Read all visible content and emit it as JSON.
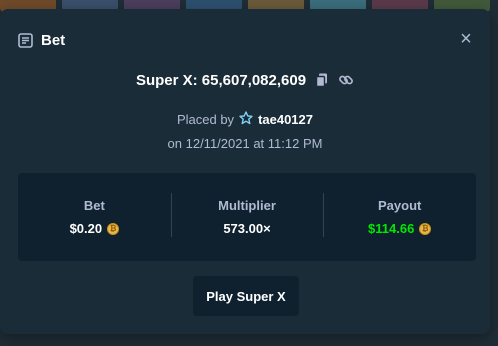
{
  "modal": {
    "title": "Bet",
    "close_label": "×"
  },
  "bet": {
    "id_text": "Super X: 65,607,082,609",
    "placed_by_label": "Placed by",
    "username": "tae40127",
    "date_text": "on 12/11/2021 at 11:12 PM"
  },
  "stats": {
    "bet_label": "Bet",
    "bet_value": "$0.20",
    "multiplier_label": "Multiplier",
    "multiplier_value": "573.00×",
    "payout_label": "Payout",
    "payout_value": "$114.66"
  },
  "actions": {
    "play_label": "Play Super X"
  },
  "icons": {
    "header": "bet-slip-icon",
    "copy": "copy-icon",
    "link": "link-icon",
    "vip": "vip-star-icon",
    "coin": "coin-icon"
  },
  "colors": {
    "modal_bg": "#1a2c38",
    "panel_bg": "#0f212e",
    "text_muted": "#b1bad3",
    "payout_green": "#00e701",
    "coin_gold": "#e8b64a"
  }
}
